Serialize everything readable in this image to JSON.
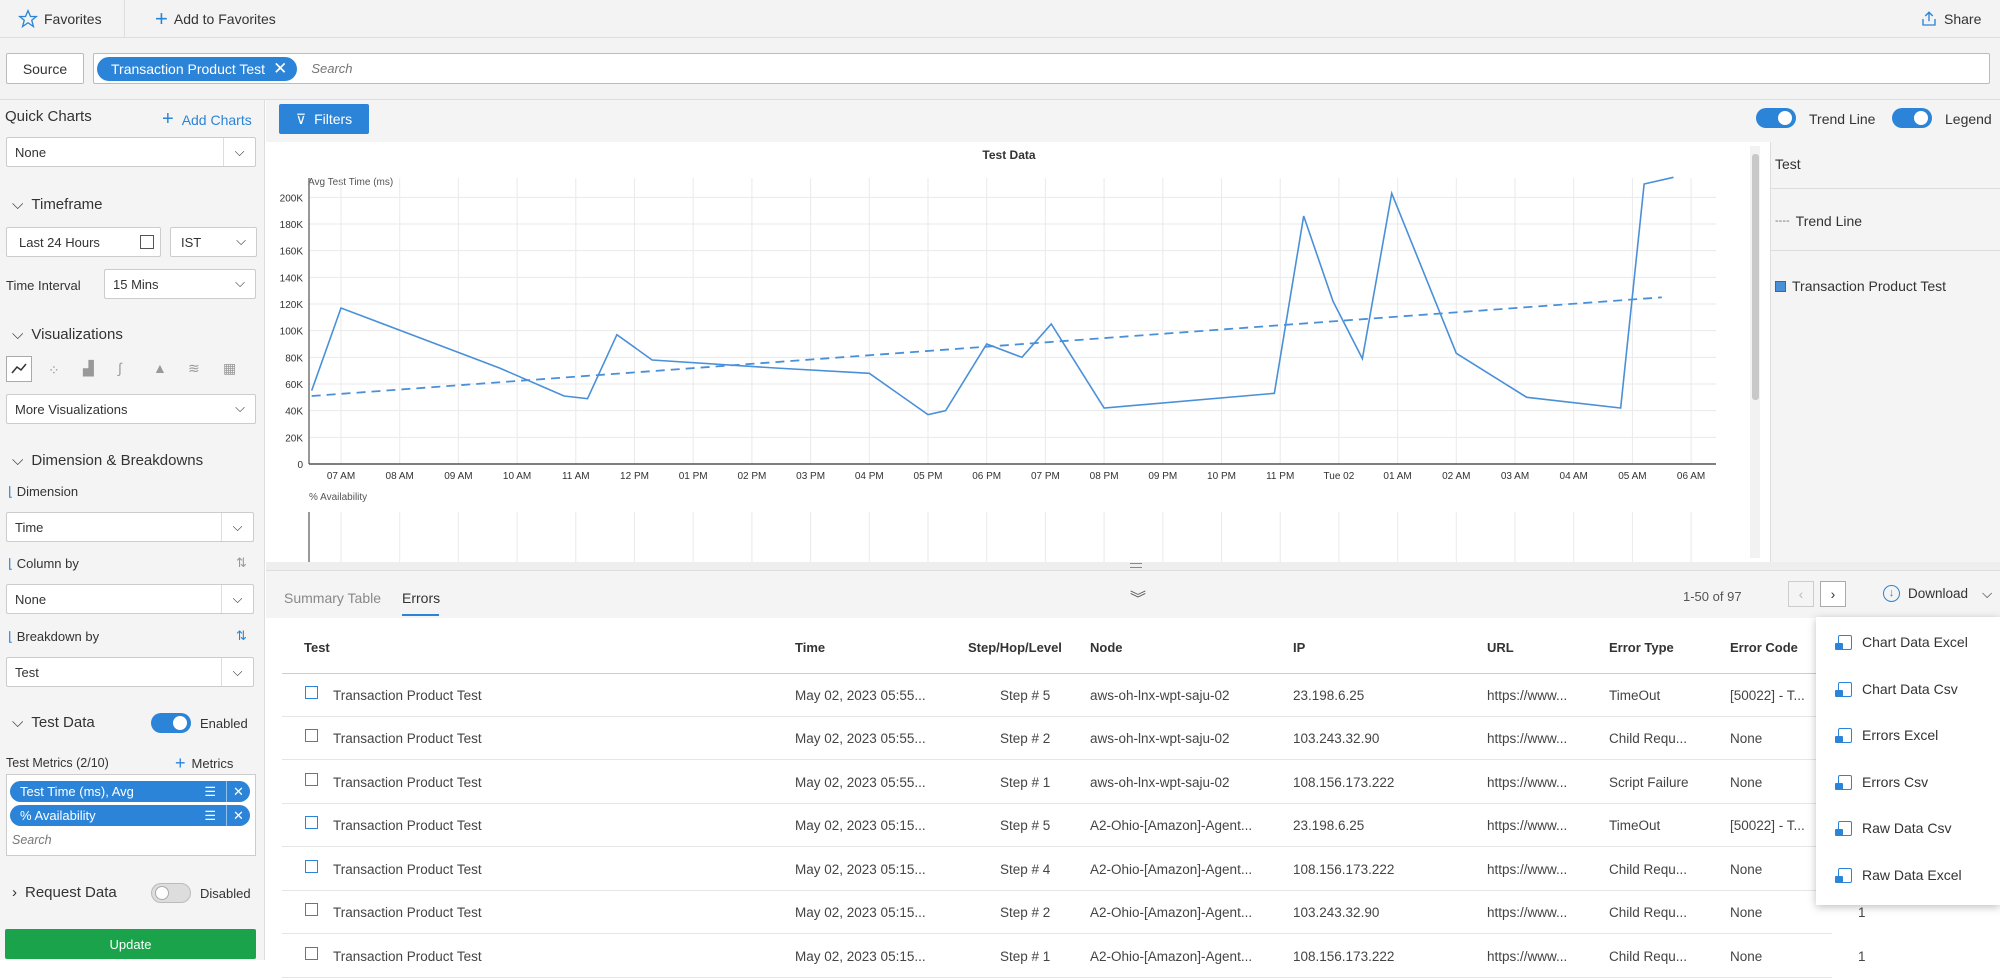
{
  "topbar": {
    "favorites": "Favorites",
    "add_favorites": "Add to Favorites",
    "share": "Share"
  },
  "source": {
    "button": "Source",
    "chip": "Transaction Product Test",
    "search_placeholder": "Search"
  },
  "left": {
    "quick_charts": "Quick Charts",
    "add_charts": "Add Charts",
    "quick_select": "None",
    "timeframe": "Timeframe",
    "timeframe_value": "Last 24 Hours",
    "timezone": "IST",
    "time_interval_label": "Time Interval",
    "time_interval": "15 Mins",
    "visualizations": "Visualizations",
    "more_visualizations": "More Visualizations",
    "dim_breakdowns": "Dimension & Breakdowns",
    "dimension_label": "Dimension",
    "dimension_value": "Time",
    "column_by_label": "Column by",
    "column_by_value": "None",
    "breakdown_label": "Breakdown by",
    "breakdown_value": "Test",
    "test_data": "Test Data",
    "test_data_state": "Enabled",
    "test_metrics": "Test Metrics (2/10)",
    "metrics_btn": "Metrics",
    "metric_chips": [
      "Test Time (ms), Avg",
      "% Availability"
    ],
    "metric_search": "Search",
    "request_data": "Request Data",
    "request_data_state": "Disabled",
    "update": "Update"
  },
  "toolbar": {
    "filters": "Filters",
    "trend_line": "Trend Line",
    "legend": "Legend"
  },
  "legend": {
    "header": "Test",
    "trend": "Trend Line",
    "series": "Transaction Product Test"
  },
  "chart_data": {
    "type": "line",
    "title": "Test Data",
    "ylabel": "Avg Test Time (ms)",
    "y_ticks": [
      "0",
      "20K",
      "40K",
      "60K",
      "80K",
      "100K",
      "120K",
      "140K",
      "160K",
      "180K",
      "200K"
    ],
    "ylim": [
      0,
      210000
    ],
    "x_ticks": [
      "07 AM",
      "08 AM",
      "09 AM",
      "10 AM",
      "11 AM",
      "12 PM",
      "01 PM",
      "02 PM",
      "03 PM",
      "04 PM",
      "05 PM",
      "06 PM",
      "07 PM",
      "08 PM",
      "09 PM",
      "10 PM",
      "11 PM",
      "Tue 02",
      "01 AM",
      "02 AM",
      "03 AM",
      "04 AM",
      "05 AM",
      "06 AM"
    ],
    "x_unit": "hours after 06:00",
    "series": [
      {
        "name": "Transaction Product Test",
        "x": [
          0.0,
          0.5,
          3.2,
          4.3,
          4.7,
          5.2,
          5.8,
          7.9,
          9.5,
          10.5,
          10.8,
          11.5,
          12.1,
          12.6,
          13.5,
          16.4,
          16.9,
          17.4,
          17.9,
          18.4,
          19.5,
          20.7,
          22.3,
          22.7,
          23.2
        ],
        "y": [
          55000,
          117000,
          72000,
          51000,
          49000,
          97000,
          78000,
          72000,
          68000,
          37000,
          40000,
          90000,
          80000,
          105000,
          42000,
          53000,
          186000,
          122000,
          79000,
          203000,
          83000,
          50000,
          42000,
          210000,
          215000
        ]
      },
      {
        "name": "Trend Line",
        "x": [
          0.0,
          23.0
        ],
        "y": [
          51000,
          125000
        ],
        "dashed": true
      }
    ],
    "second_panel_label": "% Availability"
  },
  "lower": {
    "tabs": [
      "Summary Table",
      "Errors"
    ],
    "pagination": "1-50 of 97",
    "download": "Download",
    "columns": [
      "Test",
      "Time",
      "Step/Hop/Level",
      "Node",
      "IP",
      "URL",
      "Error Type",
      "Error Code"
    ],
    "rows": [
      [
        "Transaction Product Test",
        "May 02, 2023 05:55...",
        "Step # 5",
        "aws-oh-lnx-wpt-saju-02",
        "23.198.6.25",
        "https://www...",
        "TimeOut",
        "[50022] - T..."
      ],
      [
        "Transaction Product Test",
        "May 02, 2023 05:55...",
        "Step # 2",
        "aws-oh-lnx-wpt-saju-02",
        "103.243.32.90",
        "https://www...",
        "Child Requ...",
        "None"
      ],
      [
        "Transaction Product Test",
        "May 02, 2023 05:55...",
        "Step # 1",
        "aws-oh-lnx-wpt-saju-02",
        "108.156.173.222",
        "https://www...",
        "Script Failure",
        "None"
      ],
      [
        "Transaction Product Test",
        "May 02, 2023 05:15...",
        "Step # 5",
        "A2-Ohio-[Amazon]-Agent...",
        "23.198.6.25",
        "https://www...",
        "TimeOut",
        "[50022] - T..."
      ],
      [
        "Transaction Product Test",
        "May 02, 2023 05:15...",
        "Step # 4",
        "A2-Ohio-[Amazon]-Agent...",
        "108.156.173.222",
        "https://www...",
        "Child Requ...",
        "None"
      ],
      [
        "Transaction Product Test",
        "May 02, 2023 05:15...",
        "Step # 2",
        "A2-Ohio-[Amazon]-Agent...",
        "103.243.32.90",
        "https://www...",
        "Child Requ...",
        "None"
      ],
      [
        "Transaction Product Test",
        "May 02, 2023 05:15...",
        "Step # 1",
        "A2-Ohio-[Amazon]-Agent...",
        "108.156.173.222",
        "https://www...",
        "Child Requ...",
        "None"
      ]
    ],
    "extra_col": [
      "1",
      "1"
    ],
    "download_menu": [
      "Chart Data Excel",
      "Chart Data Csv",
      "Errors Excel",
      "Errors Csv",
      "Raw Data Csv",
      "Raw Data Excel"
    ]
  },
  "colors": {
    "accent": "#2b84d8",
    "update": "#1aa34a",
    "line": "#4a90d9"
  }
}
